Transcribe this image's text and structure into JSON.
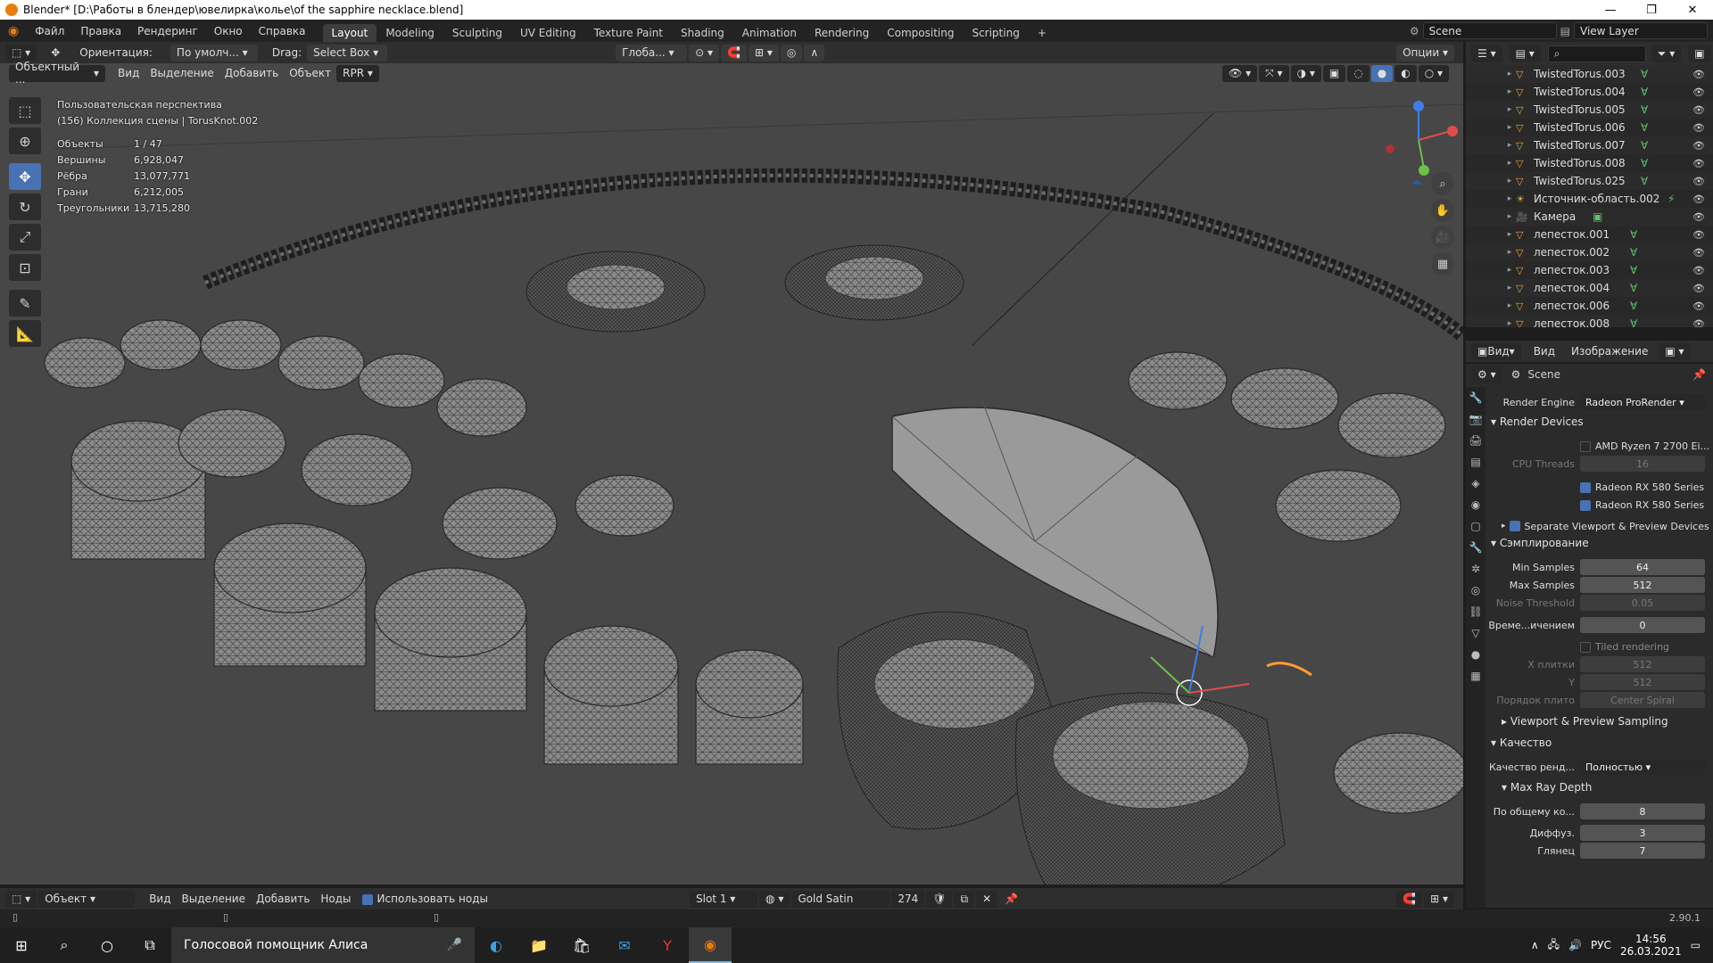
{
  "window": {
    "title": "Blender* [D:\\Работы в блендер\\ювелирка\\колье\\of the sapphire necklace.blend]",
    "controls": [
      "—",
      "❐",
      "✕"
    ]
  },
  "menu": {
    "items": [
      "Файл",
      "Правка",
      "Рендеринг",
      "Окно",
      "Справка"
    ]
  },
  "workspaces": {
    "tabs": [
      "Layout",
      "Modeling",
      "Sculpting",
      "UV Editing",
      "Texture Paint",
      "Shading",
      "Animation",
      "Rendering",
      "Compositing",
      "Scripting"
    ],
    "active": "Layout",
    "add": "+"
  },
  "scene": {
    "label": "Scene",
    "view_layer": "View Layer"
  },
  "viewport_header": {
    "orientation_label": "Ориентация:",
    "orientation_value": "По умолч...",
    "drag_label": "Drag:",
    "drag_value": "Select Box",
    "transform": "Глоба...",
    "options": "Опции",
    "mode": "Объектный ...",
    "menus": [
      "Вид",
      "Выделение",
      "Добавить",
      "Объект"
    ],
    "rpr": "RPR"
  },
  "viewport_overlay": {
    "view_name": "Пользовательская перспектива",
    "collection": "(156) Коллекция сцены | TorusKnot.002",
    "stats": [
      {
        "label": "Объекты",
        "value": "1 / 47"
      },
      {
        "label": "Вершины",
        "value": "6,928,047"
      },
      {
        "label": "Рёбра",
        "value": "13,077,771"
      },
      {
        "label": "Грани",
        "value": "6,212,005"
      },
      {
        "label": "Треугольники",
        "value": "13,715,280"
      }
    ]
  },
  "outliner": {
    "items": [
      {
        "name": "TwistedTorus.003",
        "icon": "mesh-icon"
      },
      {
        "name": "TwistedTorus.004",
        "icon": "mesh-icon"
      },
      {
        "name": "TwistedTorus.005",
        "icon": "mesh-icon"
      },
      {
        "name": "TwistedTorus.006",
        "icon": "mesh-icon"
      },
      {
        "name": "TwistedTorus.007",
        "icon": "mesh-icon"
      },
      {
        "name": "TwistedTorus.008",
        "icon": "mesh-icon"
      },
      {
        "name": "TwistedTorus.025",
        "icon": "mesh-icon"
      },
      {
        "name": "Источник-область.002",
        "icon": "light-icon"
      },
      {
        "name": "Камера",
        "icon": "camera-icon"
      },
      {
        "name": "лепесток.001",
        "icon": "mesh-icon"
      },
      {
        "name": "лепесток.002",
        "icon": "mesh-icon"
      },
      {
        "name": "лепесток.003",
        "icon": "mesh-icon"
      },
      {
        "name": "лепесток.004",
        "icon": "mesh-icon"
      },
      {
        "name": "лепесток.006",
        "icon": "mesh-icon"
      },
      {
        "name": "лепесток.008",
        "icon": "mesh-icon"
      }
    ]
  },
  "image_editor_header": {
    "menus": [
      "Вид",
      "Вид",
      "Изображение"
    ]
  },
  "properties": {
    "scene": "Scene",
    "render_engine_label": "Render Engine",
    "render_engine": "Radeon ProRender",
    "render_devices": "Render Devices",
    "cpu": "AMD Ryzen 7 2700 Ei...",
    "cpu_threads_label": "CPU Threads",
    "cpu_threads": "16",
    "gpu1": "Radeon RX 580 Series",
    "gpu2": "Radeon RX 580 Series",
    "separate_viewport": "Separate Viewport & Preview Devices",
    "sampling": "Сэмплирование",
    "min_samples_label": "Min Samples",
    "min_samples": "64",
    "max_samples_label": "Max Samples",
    "max_samples": "512",
    "noise_threshold_label": "Noise Threshold",
    "noise_threshold": "0.05",
    "time_label": "Време...ичением",
    "time_value": "0",
    "tiled_rendering": "Tiled rendering",
    "tile_x_label": "X плитки",
    "tile_x": "512",
    "tile_y_label": "Y",
    "tile_y": "512",
    "tile_order_label": "Порядок плито",
    "tile_order": "Center Spiral",
    "viewport_sampling": "Viewport & Preview Sampling",
    "quality": "Качество",
    "render_quality_label": "Качество ренд...",
    "render_quality": "Полностью",
    "max_ray_depth": "Max Ray Depth",
    "total_label": "По общему ко...",
    "total": "8",
    "diffuse_label": "Диффуз.",
    "diffuse": "3",
    "glossy_label": "Глянец",
    "glossy": "7"
  },
  "bottom_header": {
    "mode": "Объект",
    "menus": [
      "Вид",
      "Выделение",
      "Добавить",
      "Ноды"
    ],
    "use_nodes": "Использовать ноды",
    "slot": "Slot 1",
    "material": "Gold Satin",
    "users": "274"
  },
  "status": {
    "version": "2.90.1"
  },
  "taskbar": {
    "assistant": "Голосовой помощник Алиса",
    "lang": "РУС",
    "time": "14:56",
    "date": "26.03.2021"
  },
  "colors": {
    "accent": "#4772b3",
    "viewport": "#474747",
    "header": "#2e2e2e",
    "blender_orange": "#e87d0d"
  }
}
